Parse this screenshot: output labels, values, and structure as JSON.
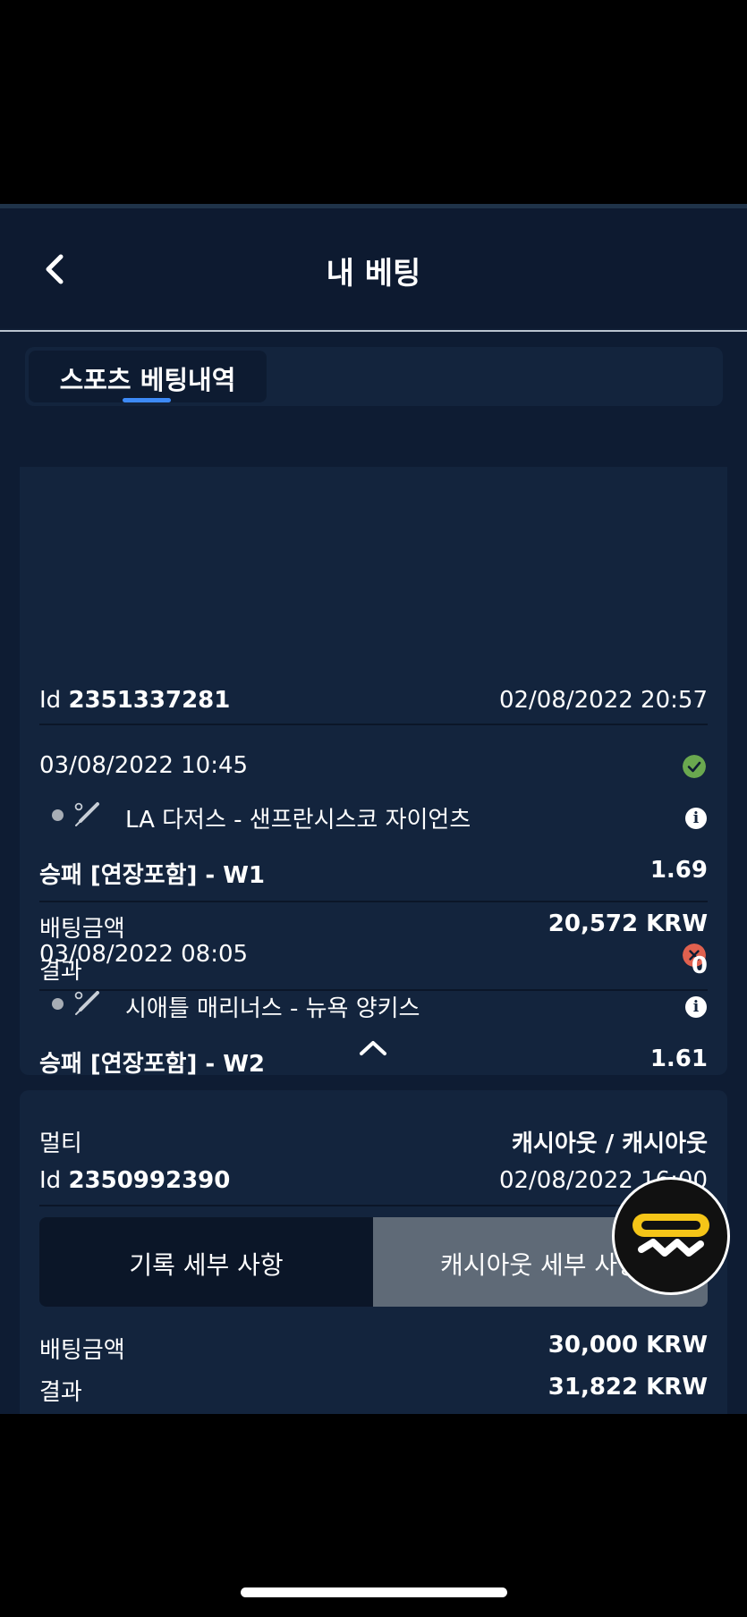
{
  "header": {
    "title": "내 베팅"
  },
  "tabs": [
    {
      "label": "스포츠 베팅내역"
    }
  ],
  "bet1": {
    "id_prefix": "Id",
    "id": "2351337281",
    "placed": "02/08/2022 20:57",
    "events": [
      {
        "datetime": "03/08/2022 10:45",
        "status": "won",
        "teams": "LA 다저스 - 샌프란시스코 자이언츠",
        "market": "승패 [연장포함] - W1",
        "odds": "1.69"
      },
      {
        "datetime": "03/08/2022 08:05",
        "status": "lost",
        "teams": "시애틀 매리너스 - 뉴욕 양키스",
        "market": "승패 [연장포함] - W2",
        "odds": "1.61"
      }
    ],
    "stake_label": "배팅금액",
    "stake": "20,572 KRW",
    "result_label": "결과",
    "result": "0"
  },
  "bet2": {
    "type": "멀티",
    "status": "캐시아웃 / 캐시아웃",
    "id_prefix": "Id",
    "id": "2350992390",
    "placed": "02/08/2022 16:00",
    "btn_history": "기록 세부 사항",
    "btn_cashout": "캐시아웃 세부 사항",
    "stake_label": "배팅금액",
    "stake": "30,000 KRW",
    "result_label": "결과",
    "result": "31,822 KRW"
  },
  "colors": {
    "won": "#6aa84f",
    "lost": "#e0614f",
    "accent": "#3d8af7",
    "fab": "#f5c518"
  },
  "icons": {
    "back": "chevron-left-icon",
    "sport": "baseball-bat-icon",
    "info": "info-icon",
    "collapse": "chevron-up-icon",
    "won": "check-circle-icon",
    "lost": "x-circle-icon",
    "fab": "logo-icon"
  }
}
